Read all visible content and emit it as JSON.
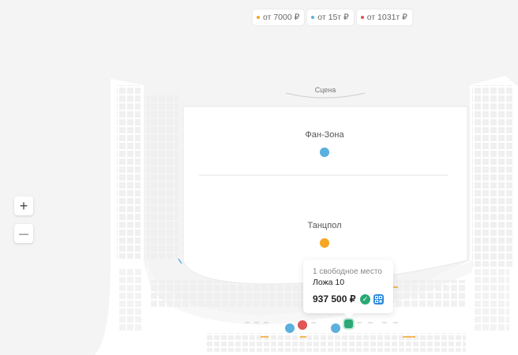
{
  "legend": [
    {
      "label": "от 7000 ₽",
      "color": "#f5a623"
    },
    {
      "label": "от 15т ₽",
      "color": "#5ab0de"
    },
    {
      "label": "от 1031т ₽",
      "color": "#e05555"
    }
  ],
  "zoom": {
    "in_symbol": "+",
    "out_symbol": "—"
  },
  "venue": {
    "stage_label": "Сцена",
    "fanzone_label": "Фан-Зона",
    "dancefloor_label": "Танцпол"
  },
  "colors": {
    "orange": "#f5a623",
    "blue": "#5ab0de",
    "red": "#e05555",
    "green": "#2aa876"
  },
  "tooltip": {
    "availability": "1 свободное место",
    "name": "Ложа 10",
    "price": "937 500 ₽",
    "check_icon": "✓"
  }
}
